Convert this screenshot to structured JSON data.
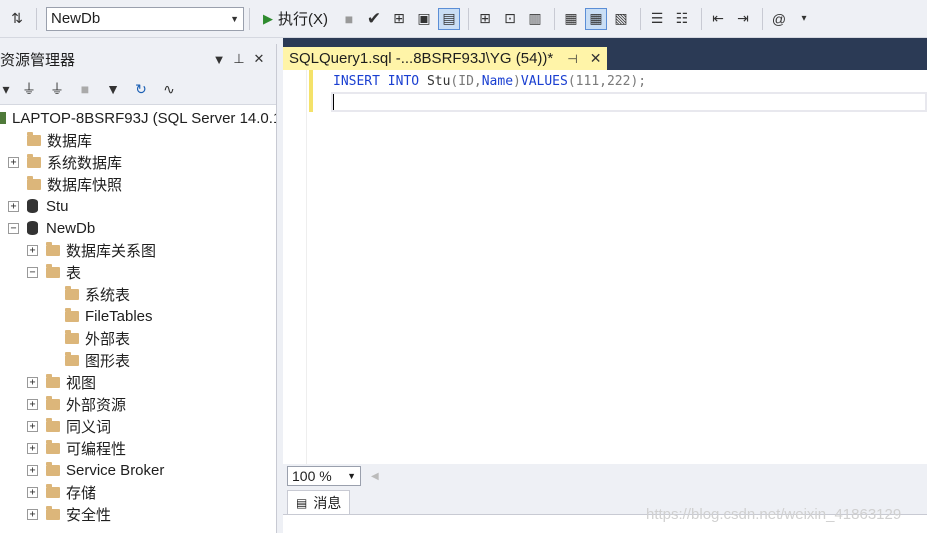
{
  "toolbar": {
    "database": "NewDb",
    "execute_label": "执行(X)"
  },
  "object_explorer": {
    "title": "资源管理器",
    "tree": [
      {
        "label": "LAPTOP-8BSRF93J (SQL Server 14.0.1",
        "level": 0,
        "expander": "",
        "icon": "server-icon"
      },
      {
        "label": "数据库",
        "level": 0,
        "expander": "",
        "icon": "folder-icon"
      },
      {
        "label": "系统数据库",
        "level": 1,
        "expander": "+",
        "icon": "folder-icon"
      },
      {
        "label": "数据库快照",
        "level": 1,
        "expander": "",
        "icon": "folder-icon"
      },
      {
        "label": "Stu",
        "level": 1,
        "expander": "+",
        "icon": "database-icon"
      },
      {
        "label": "NewDb",
        "level": 1,
        "expander": "−",
        "icon": "database-icon"
      },
      {
        "label": "数据库关系图",
        "level": 2,
        "expander": "+",
        "icon": "folder-icon"
      },
      {
        "label": "表",
        "level": 2,
        "expander": "−",
        "icon": "folder-icon"
      },
      {
        "label": "系统表",
        "level": 3,
        "expander": "",
        "icon": "folder-icon"
      },
      {
        "label": "FileTables",
        "level": 3,
        "expander": "",
        "icon": "folder-icon"
      },
      {
        "label": "外部表",
        "level": 3,
        "expander": "",
        "icon": "folder-icon"
      },
      {
        "label": "图形表",
        "level": 3,
        "expander": "",
        "icon": "folder-icon"
      },
      {
        "label": "视图",
        "level": 2,
        "expander": "+",
        "icon": "folder-icon"
      },
      {
        "label": "外部资源",
        "level": 2,
        "expander": "+",
        "icon": "folder-icon"
      },
      {
        "label": "同义词",
        "level": 2,
        "expander": "+",
        "icon": "folder-icon"
      },
      {
        "label": "可编程性",
        "level": 2,
        "expander": "+",
        "icon": "folder-icon"
      },
      {
        "label": "Service Broker",
        "level": 2,
        "expander": "+",
        "icon": "folder-icon"
      },
      {
        "label": "存储",
        "level": 2,
        "expander": "+",
        "icon": "folder-icon"
      },
      {
        "label": "安全性",
        "level": 2,
        "expander": "+",
        "icon": "folder-icon"
      }
    ]
  },
  "editor": {
    "tab_title": "SQLQuery1.sql -...8BSRF93J\\YG (54))*",
    "code": {
      "kw1": "INSERT",
      "kw2": "INTO",
      "table": "Stu",
      "cols": "(ID,",
      "col2": "Name",
      "close": ")",
      "kw3": "VALUES",
      "vals": "(111,222)",
      "semi": ";"
    },
    "zoom": "100 %"
  },
  "results": {
    "messages_tab": "消息"
  },
  "watermark": "https://blog.csdn.net/weixin_41863129"
}
